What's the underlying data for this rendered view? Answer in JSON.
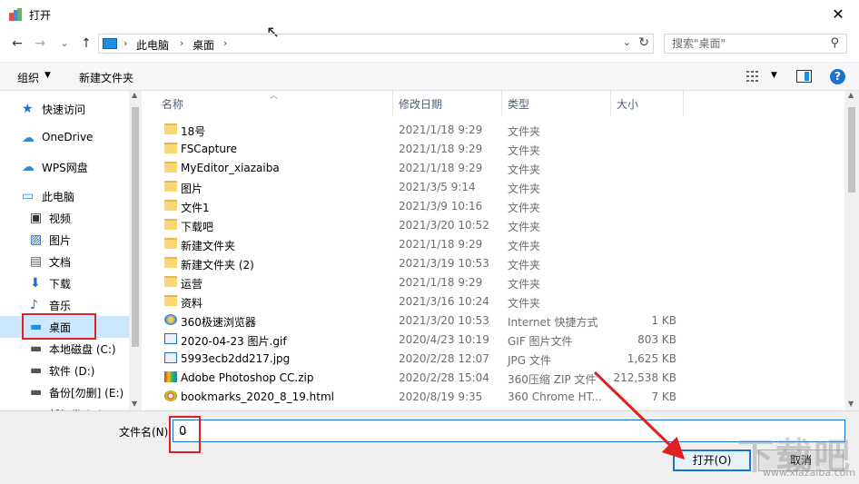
{
  "window": {
    "title": "打开",
    "close_glyph": "✕"
  },
  "nav": {
    "back_glyph": "←",
    "forward_glyph": "→",
    "recent_glyph": "⌄",
    "up_glyph": "↑",
    "breadcrumb": [
      "此电脑",
      "桌面"
    ],
    "refresh_glyph": "↻",
    "search_placeholder": "搜索\"桌面\""
  },
  "toolbar": {
    "organize": "组织",
    "new_folder": "新建文件夹",
    "help": "?"
  },
  "sidebar": {
    "items": [
      {
        "label": "快速访问",
        "icon": "star-icon"
      },
      {
        "label": "OneDrive",
        "icon": "cloud-icon"
      },
      {
        "label": "WPS网盘",
        "icon": "cloud-icon"
      },
      {
        "label": "此电脑",
        "icon": "computer-icon"
      },
      {
        "label": "视频",
        "icon": "video-icon"
      },
      {
        "label": "图片",
        "icon": "picture-icon"
      },
      {
        "label": "文档",
        "icon": "document-icon"
      },
      {
        "label": "下载",
        "icon": "download-icon"
      },
      {
        "label": "音乐",
        "icon": "music-icon"
      },
      {
        "label": "桌面",
        "icon": "desktop-icon",
        "selected": true
      },
      {
        "label": "本地磁盘 (C:)",
        "icon": "drive-icon"
      },
      {
        "label": "软件 (D:)",
        "icon": "drive-icon"
      },
      {
        "label": "备份[勿删] (E:)",
        "icon": "drive-icon"
      },
      {
        "label": "新加卷 (F:)",
        "icon": "drive-icon"
      }
    ]
  },
  "filelist": {
    "columns": {
      "name": "名称",
      "date": "修改日期",
      "type": "类型",
      "size": "大小"
    },
    "rows": [
      {
        "name": "18号",
        "date": "2021/1/18 9:29",
        "type": "文件夹",
        "size": "",
        "icon": "folder-icon"
      },
      {
        "name": "FSCapture",
        "date": "2021/1/18 9:29",
        "type": "文件夹",
        "size": "",
        "icon": "folder-icon"
      },
      {
        "name": "MyEditor_xiazaiba",
        "date": "2021/1/18 9:29",
        "type": "文件夹",
        "size": "",
        "icon": "folder-icon"
      },
      {
        "name": "图片",
        "date": "2021/3/5 9:14",
        "type": "文件夹",
        "size": "",
        "icon": "folder-icon"
      },
      {
        "name": "文件1",
        "date": "2021/3/9 10:16",
        "type": "文件夹",
        "size": "",
        "icon": "folder-icon"
      },
      {
        "name": "下载吧",
        "date": "2021/3/20 10:52",
        "type": "文件夹",
        "size": "",
        "icon": "folder-icon"
      },
      {
        "name": "新建文件夹",
        "date": "2021/1/18 9:29",
        "type": "文件夹",
        "size": "",
        "icon": "folder-icon"
      },
      {
        "name": "新建文件夹 (2)",
        "date": "2021/3/19 10:53",
        "type": "文件夹",
        "size": "",
        "icon": "folder-icon"
      },
      {
        "name": "运营",
        "date": "2021/1/18 9:29",
        "type": "文件夹",
        "size": "",
        "icon": "folder-icon"
      },
      {
        "name": "资料",
        "date": "2021/3/16 10:24",
        "type": "文件夹",
        "size": "",
        "icon": "folder-icon"
      },
      {
        "name": "360极速浏览器",
        "date": "2021/3/20 10:53",
        "type": "Internet 快捷方式",
        "size": "1 KB",
        "icon": "browser-icon"
      },
      {
        "name": "2020-04-23 图片.gif",
        "date": "2020/4/23 10:19",
        "type": "GIF 图片文件",
        "size": "803 KB",
        "icon": "image-file-icon"
      },
      {
        "name": "5993ecb2dd217.jpg",
        "date": "2020/2/28 12:07",
        "type": "JPG 文件",
        "size": "1,625 KB",
        "icon": "image-file-icon"
      },
      {
        "name": "Adobe Photoshop CC.zip",
        "date": "2020/2/28 15:04",
        "type": "360压缩 ZIP 文件",
        "size": "212,538 KB",
        "icon": "zip-icon"
      },
      {
        "name": "bookmarks_2020_8_19.html",
        "date": "2020/8/19 9:35",
        "type": "360 Chrome HT...",
        "size": "7 KB",
        "icon": "html-file-icon"
      }
    ]
  },
  "bottom": {
    "filename_label": "文件名(N):",
    "filename_value": "0",
    "open_label": "打开(O)",
    "cancel_label": "取消"
  },
  "watermark": {
    "main": "下载吧",
    "sub": "www.xiazaiba.com"
  },
  "colors": {
    "accent": "#1874d0",
    "annotation": "#e02020",
    "folder": "#f8d775"
  }
}
